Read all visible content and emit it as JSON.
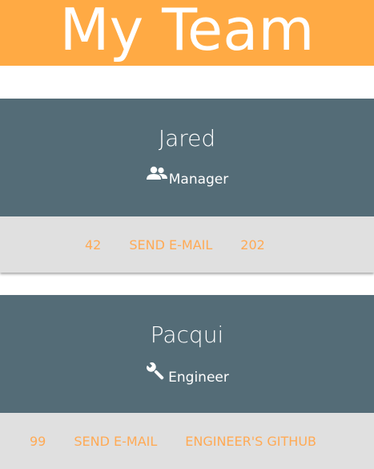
{
  "header": {
    "title": "My Team",
    "bg_color": "#ffaa44",
    "text_color": "#ffffff"
  },
  "team": [
    {
      "name": "Jared",
      "role": "Manager",
      "role_icon": "people-icon",
      "actions": [
        "42",
        "SEND E-MAIL",
        "202"
      ]
    },
    {
      "name": "Pacqui",
      "role": "Engineer",
      "role_icon": "wrench-icon",
      "actions": [
        "99",
        "SEND E-MAIL",
        "ENGINEER'S GITHUB"
      ]
    }
  ],
  "colors": {
    "card_top": "#546c77",
    "card_bottom": "#e0e0e0",
    "link": "#ffaa55"
  }
}
